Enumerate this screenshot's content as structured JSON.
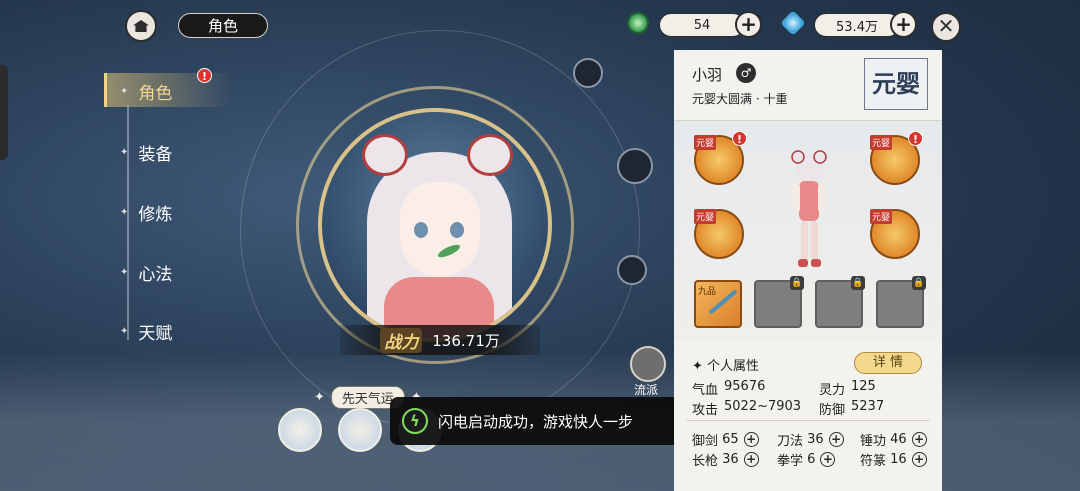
{
  "header": {
    "title": "角色",
    "jade": {
      "value": "54"
    },
    "spirit_stone": {
      "value": "53.4万"
    }
  },
  "nav": {
    "items": [
      {
        "label": "角色",
        "active": true,
        "badge": "!"
      },
      {
        "label": "装备"
      },
      {
        "label": "修炼"
      },
      {
        "label": "心法"
      },
      {
        "label": "天赋"
      }
    ]
  },
  "portrait": {
    "power_label": "战力",
    "power_value": "136.71万"
  },
  "fortune": {
    "title": "先天气运"
  },
  "side_buttons": {
    "liupai": "流派"
  },
  "toast": {
    "icon": "lightning-icon",
    "text": "闪电启动成功，游戏快人一步"
  },
  "character": {
    "name": "小羽",
    "realm": "元婴大圆满 · 十重",
    "realm_badge": "元婴",
    "equipment_tag": "元婴",
    "weapon_tag": "九品"
  },
  "attributes": {
    "title": "个人属性",
    "detail_button": "详 情",
    "stats": [
      {
        "key": "气血",
        "value": "95676"
      },
      {
        "key": "灵力",
        "value": "125"
      },
      {
        "key": "攻击",
        "value": "5022~7903"
      },
      {
        "key": "防御",
        "value": "5237"
      }
    ],
    "skills": [
      {
        "key": "御剑",
        "value": "65"
      },
      {
        "key": "刀法",
        "value": "36"
      },
      {
        "key": "锤功",
        "value": "46"
      },
      {
        "key": "长枪",
        "value": "36"
      },
      {
        "key": "拳学",
        "value": "6"
      },
      {
        "key": "符篆",
        "value": "16"
      }
    ]
  },
  "colors": {
    "accent_gold": "#f3d58c",
    "badge_red": "#d7342e",
    "toast_green": "#7fdc5d"
  }
}
